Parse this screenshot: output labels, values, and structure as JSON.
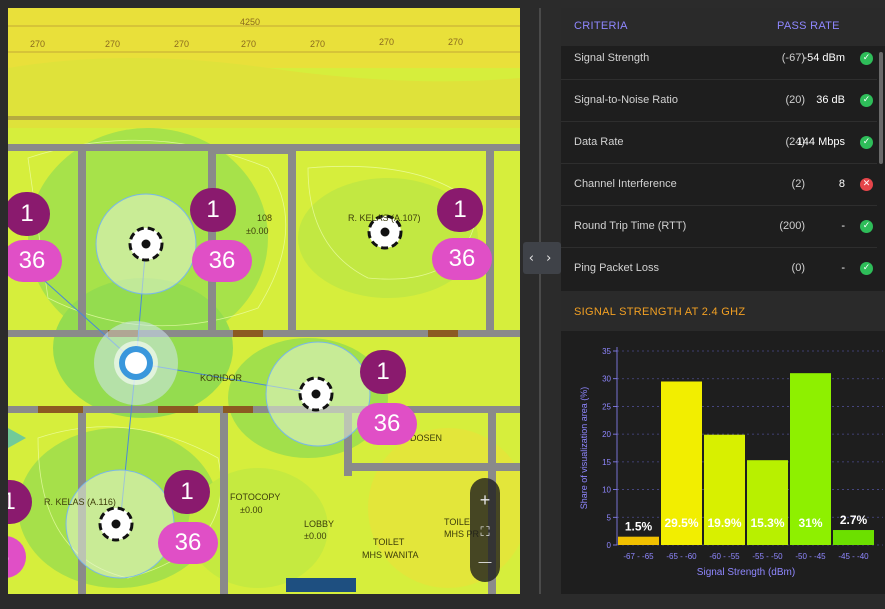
{
  "map": {
    "top_labels": [
      "4250",
      "270",
      "270",
      "270",
      "270",
      "270",
      "270",
      "270",
      "270"
    ],
    "room_labels": {
      "r108_name": "108",
      "r108_val": "±0.00",
      "ruang_kelas_1": "R. KELAS (A.107)",
      "koridor": "KORIDOR",
      "dosen": "DOSEN",
      "fotocopy_name": "FOTOCOPY",
      "fotocopy_val": "±0.00",
      "lobby_name": "LOBBY",
      "lobby_val": "±0.00",
      "toilet1_name": "TOILET",
      "toilet1_sub": "MHS WANITA",
      "toilet2_name": "TOILE",
      "toilet2_sub": "MHS PR",
      "ruang_kelas_2": "R. KELAS (A.116)"
    },
    "access_points": [
      {
        "count": "1",
        "channel": "36"
      },
      {
        "count": "1",
        "channel": "36"
      },
      {
        "count": "1",
        "channel": "36"
      },
      {
        "count": "1",
        "channel": "36"
      },
      {
        "count": "1",
        "channel": "36"
      },
      {
        "count": "1",
        "channel": "36"
      }
    ],
    "zoom": {
      "in": "+",
      "fit": "⛶",
      "out": "—"
    }
  },
  "divider": {
    "toggle_label": "‹ ›"
  },
  "criteria": {
    "header_criteria": "CRITERIA",
    "header_pass_rate": "PASS RATE",
    "rows": [
      {
        "label": "Signal Strength",
        "required": "(-67)",
        "value": "-54 dBm",
        "status": "pass"
      },
      {
        "label": "Signal-to-Noise Ratio",
        "required": "(20)",
        "value": "36 dB",
        "status": "pass"
      },
      {
        "label": "Data Rate",
        "required": "(24)",
        "value": "144 Mbps",
        "status": "pass"
      },
      {
        "label": "Channel Interference",
        "required": "(2)",
        "value": "8",
        "status": "fail"
      },
      {
        "label": "Round Trip Time (RTT)",
        "required": "(200)",
        "value": "-",
        "status": "pass"
      },
      {
        "label": "Ping Packet Loss",
        "required": "(0)",
        "value": "-",
        "status": "pass"
      }
    ]
  },
  "signal_section": {
    "title": "SIGNAL STRENGTH AT 2.4 GHZ"
  },
  "colors": {
    "accent_purple": "#8f87ff",
    "accent_orange": "#f2a023",
    "pass_green": "#2ebd59",
    "fail_red": "#e5454a"
  },
  "chart_data": {
    "type": "bar",
    "categories": [
      "-67 - -65",
      "-65 - -60",
      "-60 - -55",
      "-55 - -50",
      "-50 - -45",
      "-45 - -40"
    ],
    "values": [
      1.5,
      29.5,
      19.9,
      15.3,
      31,
      2.7
    ],
    "data_labels": [
      "1.5%",
      "29.5%",
      "19.9%",
      "15.3%",
      "31%",
      "2.7%"
    ],
    "bar_colors": [
      "#f0c000",
      "#f2ee00",
      "#d8f000",
      "#b8f000",
      "#8ef000",
      "#6ce000"
    ],
    "xlabel": "Signal Strength (dBm)",
    "ylabel": "Share of visualization area (%)",
    "ylim": [
      0,
      35
    ],
    "yticks": [
      0,
      5,
      10,
      15,
      20,
      25,
      30,
      35
    ],
    "grid": true
  }
}
